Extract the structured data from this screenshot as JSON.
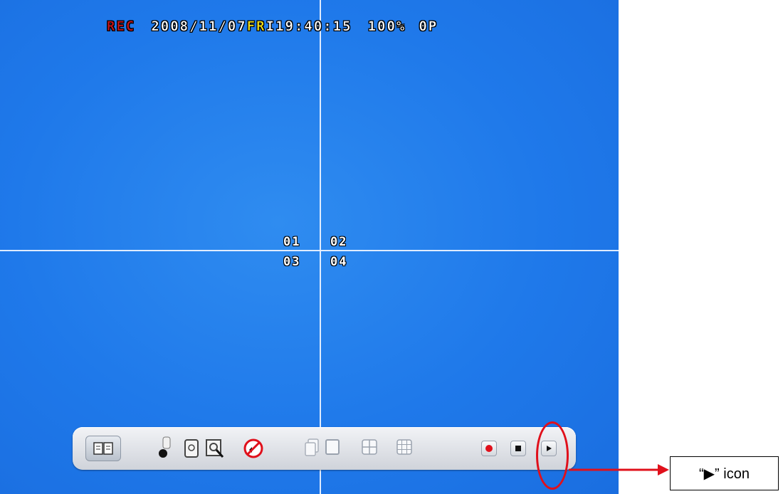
{
  "osd": {
    "rec": "REC",
    "date": "2008/11/07",
    "day_prefix": "F",
    "day_suffix": "R",
    "hour": "I19",
    "time_rest": ":40:15",
    "zoom": "100%",
    "op": "0P"
  },
  "channels": [
    "01",
    "02",
    "03",
    "04"
  ],
  "toolbar": {
    "icons": [
      "manual-icon",
      "camera-icon",
      "hdd-icon",
      "search-icon",
      "audio-mute-icon",
      "multi-page-icon",
      "single-view-icon",
      "quad-view-icon",
      "nine-view-icon",
      "record-icon",
      "stop-icon",
      "play-icon"
    ]
  },
  "annotation": {
    "callout_text": "“▶” icon"
  },
  "colors": {
    "screen_blue": "#1f79ea",
    "rec_red": "#c7131a",
    "annotation_red": "#e0101b",
    "osd_yellow": "#f5e21a"
  }
}
